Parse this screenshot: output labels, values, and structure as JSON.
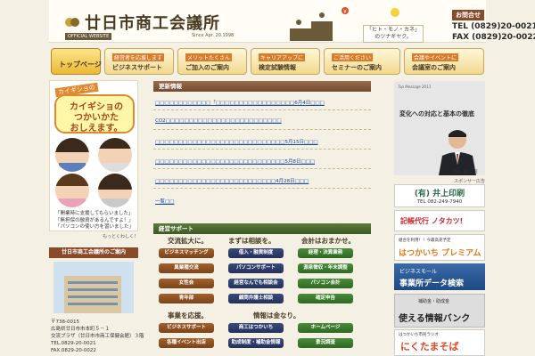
{
  "header": {
    "title": "廿日市商工会議所",
    "official": "OFFICIAL WEBSITE",
    "since": "Since Apr. 20.1998",
    "tagline_line1": "「ヒト・モノ・カネ」",
    "tagline_line2": "のツナギヤク。",
    "contact_label": "お問合せ",
    "tel": "TEL (0829)20-0021",
    "fax": "FAX (0829)20-0022"
  },
  "nav": {
    "items": [
      {
        "sub": "",
        "main": "トップページ"
      },
      {
        "sub": "経営者を応援します",
        "main": "ビジネスサポート"
      },
      {
        "sub": "メリットたくさん",
        "main": "ご加入のご案内"
      },
      {
        "sub": "キャリアアップに",
        "main": "検定試験情報"
      },
      {
        "sub": "ご活用ください",
        "main": "セミナーのご案内"
      },
      {
        "sub": "会議やイベントに",
        "main": "会議室のご案内"
      }
    ]
  },
  "promo": {
    "small": "カイギショの",
    "line1": "カイギショの",
    "line2": "つかいかた",
    "line3": "おしえます。",
    "quote1": "「開業時に支援してもらいました」",
    "quote2": "「無担保の融資があるんですよ！」",
    "quote3": "「パソコンの使い方を習いました」",
    "more": "もっとくわしく！"
  },
  "branch": {
    "heading": "廿日市商工会議所のご案内",
    "postal": "〒738-0015",
    "address1": "広島県廿日市市本町５－１",
    "address2": "交流プラザ（廿日市市商工保健会館）３階",
    "tel": "TEL.0829-20-0021",
    "fax": "FAX.0829-20-0022"
  },
  "news": {
    "heading": "更新情報",
    "items": [
      "□□□□□□□□□□□□「□□□□□□□□□□□□□□□□□6月4日□□□",
      "CO2□□□□□□□□□□□□□□□□□□□□□□□□□",
      "□□□□□□□□□□□□□□□□□□□□□□□□□□□□5月15日□□□",
      "□□□□□□□□□□□□□□□□□□□□□□□□□□□□5月8日□□□",
      "□□□□□□□□□□□□□□□□□□□□□□□□□□4月28日□□□"
    ],
    "more": "一覧□□"
  },
  "support": {
    "heading": "経営サポート",
    "col1_header": "交流拡大に。",
    "col2_header": "まずは相談を。",
    "col3_header": "会計はおまかせ。",
    "col1_header_b": "事業を応援。",
    "col2_header_b": "情報は金なり。",
    "col1": [
      "ビジネスマッチング",
      "異業種交流",
      "女性会",
      "青年部"
    ],
    "col2": [
      "借入・融資制度",
      "パソコンサポート",
      "経営なんでも相談会",
      "顧問弁護士相談"
    ],
    "col3": [
      "経理・決算業務",
      "源泉徴収・年末調整",
      "パソコン会計",
      "確定申告"
    ],
    "row2_col1": [
      "ビジネスサポート",
      "各種イベント出店"
    ],
    "row2_col2": [
      "商工はつかいち",
      "助成制度・補助金情報"
    ],
    "row2_col3": [
      "ホームページ",
      "景況調査"
    ]
  },
  "message": {
    "small": "Top Message 2013",
    "title": "変化への対応と基本の徹底",
    "name": "会頭　細川　匠"
  },
  "sponsor": {
    "label": "スポンサー広告",
    "ad1_title": "(有) 井上印刷",
    "ad1_tel": "TEL 082-249-7940",
    "ad2_text": "記帳代行 ノタカツ!",
    "ad3_top": "組合を利用！！今最高売予定",
    "ad3_bottom": "はつかいち プレミアム",
    "ad4_top": "ビジネスモール",
    "ad4_bottom": "事業所データ検索",
    "ad5_top": "補助金・助成金",
    "ad5_bottom": "使える情報バンク",
    "ad6_top": "はつかいち市民ラジオ",
    "ad6_bottom": "にくたまそば"
  },
  "colors": {
    "background": "#f5f0e4",
    "nav_active": "#e9b935",
    "brown_button": "#7a4418",
    "navy_button": "#23305a",
    "green_button": "#2e6a22",
    "link": "#1a4aa8"
  }
}
